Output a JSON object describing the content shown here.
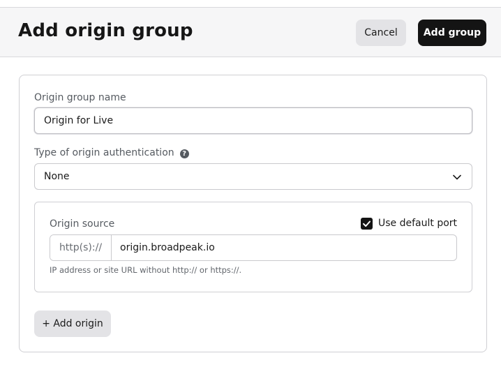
{
  "header": {
    "title": "Add origin group",
    "cancel_label": "Cancel",
    "add_group_label": "Add group"
  },
  "form": {
    "group_name_label": "Origin group name",
    "group_name_value": "Origin for Live",
    "auth_label": "Type of origin authentication",
    "auth_help_icon": "question-circle-icon",
    "auth_value": "None",
    "origin": {
      "source_label": "Origin source",
      "use_default_port_label": "Use default port",
      "use_default_port_checked": true,
      "protocol_prefix": "http(s)://",
      "url_value": "origin.broadpeak.io",
      "hint": "IP address or site URL without http:// or https://."
    },
    "add_origin_label": "+ Add origin"
  },
  "colors": {
    "primary_button": "#141414",
    "secondary_button": "#e3e3e6",
    "header_bg": "#f6f6f7"
  }
}
